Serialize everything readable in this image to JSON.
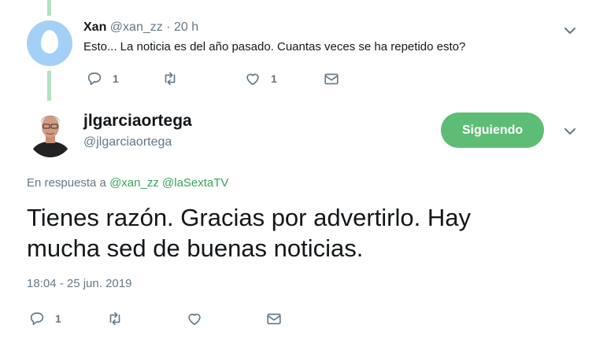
{
  "reply": {
    "author_name": "Xan",
    "author_handle": "@xan_zz",
    "time": "· 20 h",
    "text": "Esto... La noticia es del año pasado. Cuantas veces se ha repetido esto?",
    "reply_count": "1",
    "like_count": "1"
  },
  "main": {
    "author_name": "jlgarciaortega",
    "author_handle": "@jlgarciaortega",
    "follow_label": "Siguiendo",
    "replying_prefix": "En respuesta a",
    "replying_user1": "@xan_zz",
    "replying_user2": "@laSextaTV",
    "text_line1": "Tienes razón. Gracias por advertirlo. Hay",
    "text_line2": "mucha sed de buenas noticias.",
    "timestamp": "18:04 - 25 jun. 2019",
    "reply_count": "1"
  },
  "colors": {
    "accent_green": "#5ebd74",
    "thread_line": "#b5e0c1",
    "muted_text": "#657786"
  }
}
